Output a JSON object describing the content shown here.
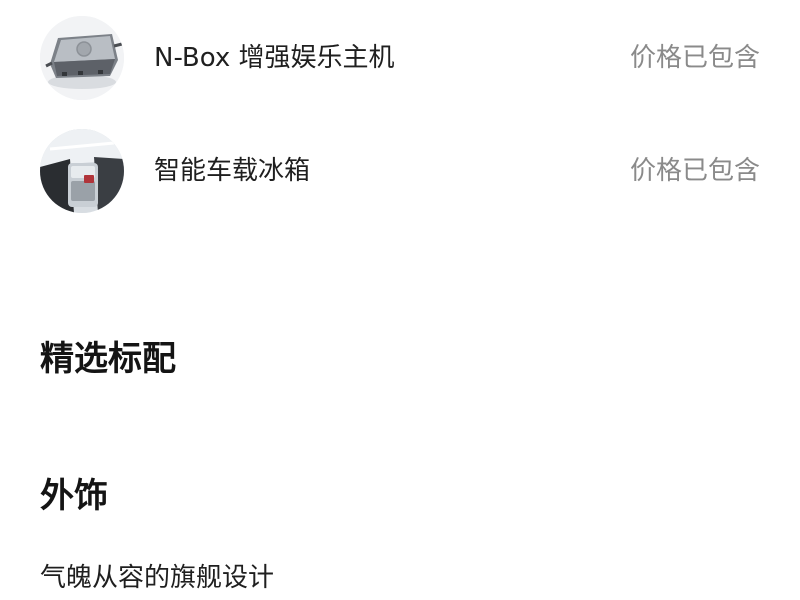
{
  "options": [
    {
      "name": "N-Box 增强娱乐主机",
      "price_status": "价格已包含",
      "thumbnail": "entertainment-box-device-image"
    },
    {
      "name": "智能车载冰箱",
      "price_status": "价格已包含",
      "thumbnail": "car-interior-fridge-image"
    }
  ],
  "sections": [
    {
      "title": "精选标配"
    },
    {
      "title": "外饰",
      "description": "气魄从容的旗舰设计"
    }
  ]
}
